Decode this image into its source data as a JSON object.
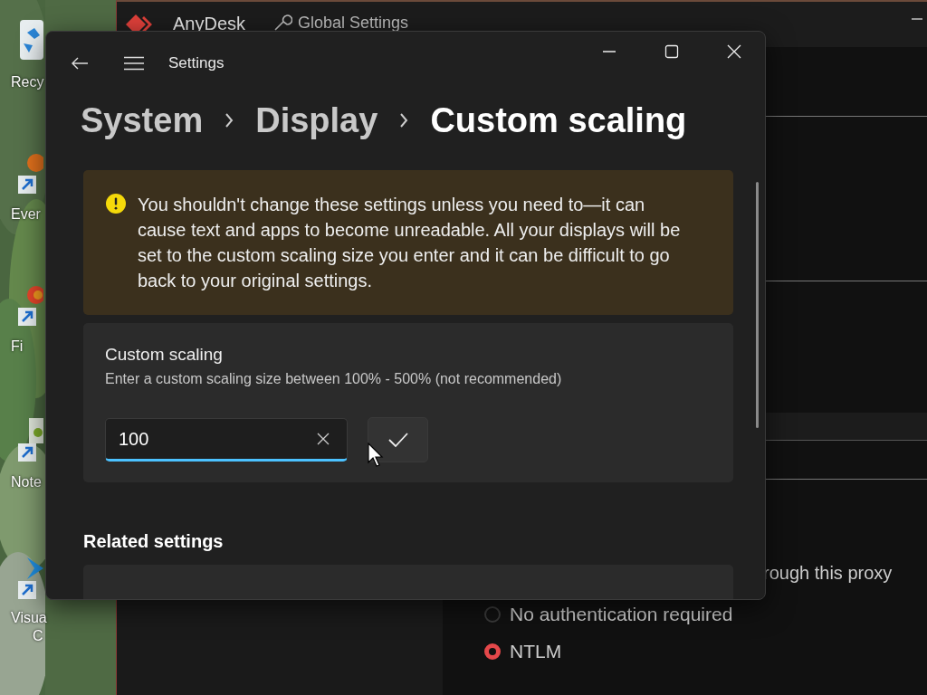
{
  "desktop": {
    "kind": "picture",
    "icons": [
      {
        "label": "Recy",
        "kind": "bin"
      },
      {
        "label": "Ever",
        "kind": "orange"
      },
      {
        "label": "Fi",
        "kind": "fox"
      },
      {
        "label": "Note",
        "kind": "notes"
      },
      {
        "label": "Visua",
        "kind": "code",
        "label_2": "C"
      }
    ]
  },
  "background_window": {
    "title": "AnyDesk",
    "tab": "Global Settings",
    "proxy_text": "rough this proxy",
    "auth_options": [
      {
        "label": "No authentication required",
        "selected": false
      },
      {
        "label": "NTLM",
        "selected": true
      }
    ]
  },
  "settings_window": {
    "title": "Settings",
    "breadcrumb": [
      {
        "label": "System",
        "current": false
      },
      {
        "label": "Display",
        "current": false
      },
      {
        "label": "Custom scaling",
        "current": true
      }
    ],
    "warning": "You shouldn't change these settings unless you need to—it can cause text and apps to become unreadable. All your displays will be set to the custom scaling size you enter and it can be difficult to go back to your original settings.",
    "custom_scaling": {
      "title": "Custom scaling",
      "description": "Enter a custom scaling size between 100% - 500% (not recommended)",
      "input": {
        "value": "100",
        "focused": true
      }
    },
    "related_settings": {
      "title": "Related settings"
    }
  }
}
